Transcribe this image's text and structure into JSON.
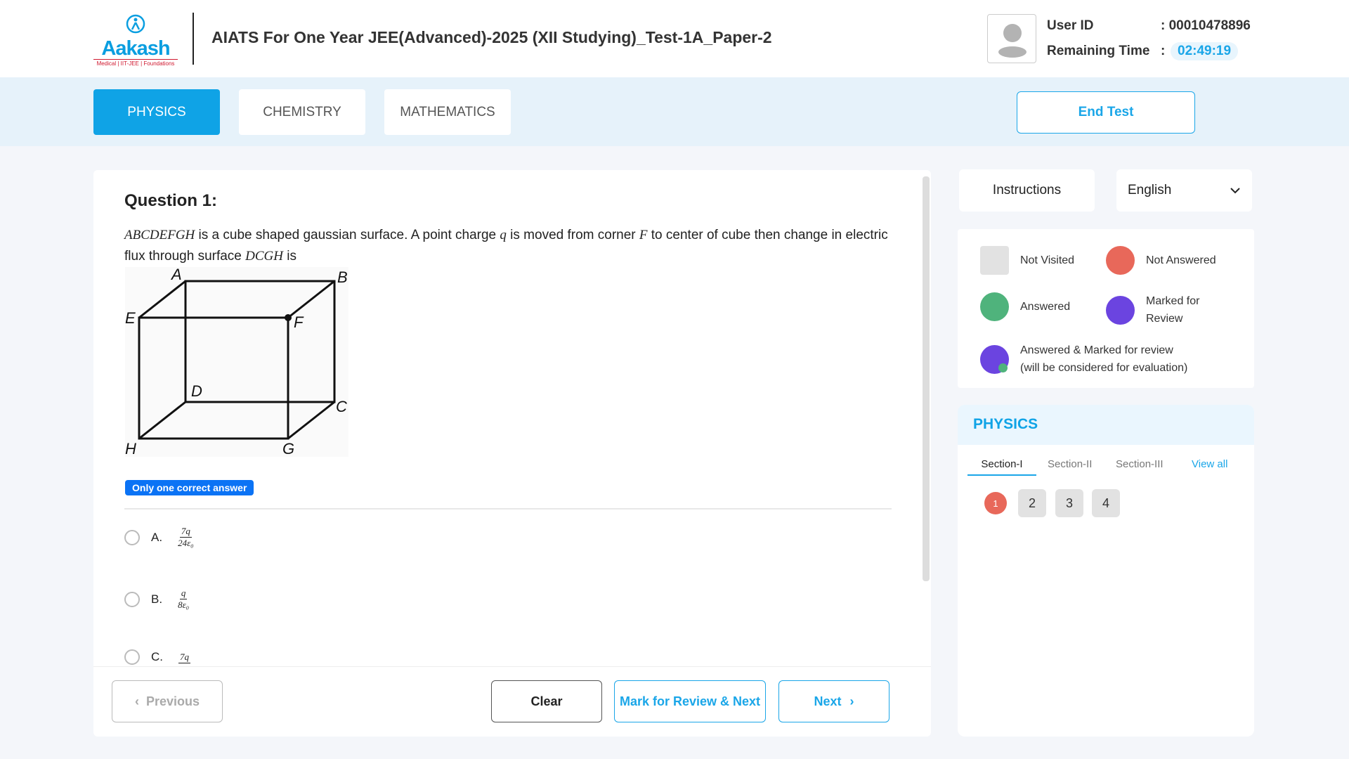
{
  "header": {
    "logo_text": "Aakash",
    "logo_sub": "Medical | IIT-JEE | Foundations",
    "title": "AIATS For One Year JEE(Advanced)-2025 (XII Studying)_Test-1A_Paper-2",
    "user_id_label": "User ID",
    "user_id": ": 00010478896",
    "time_label": "Remaining Time",
    "time_sep": ":",
    "time": "02:49:19"
  },
  "tabs": [
    {
      "label": "PHYSICS",
      "active": true
    },
    {
      "label": "CHEMISTRY"
    },
    {
      "label": "MATHEMATICS"
    }
  ],
  "end_test": "End Test",
  "question": {
    "title": "Question 1:",
    "text_parts": [
      "ABCDEFGH",
      " is a cube shaped gaussian surface. A point charge ",
      "q",
      " is moved from corner ",
      "F",
      " to center of cube then change in electric flux through surface ",
      "DCGH",
      " is"
    ],
    "figure_labels": {
      "A": "A",
      "B": "B",
      "C": "C",
      "D": "D",
      "E": "E",
      "F": "F",
      "G": "G",
      "H": "H"
    },
    "badge": "Only one correct answer",
    "options": [
      {
        "label": "A.",
        "num": "7q",
        "den": "24ε₀"
      },
      {
        "label": "B.",
        "num": "q",
        "den": "8ε₀"
      },
      {
        "label": "C.",
        "num": "7q",
        "den": ""
      }
    ]
  },
  "footer": {
    "previous": "Previous",
    "clear": "Clear",
    "mark": "Mark for Review & Next",
    "next": "Next"
  },
  "right": {
    "instructions": "Instructions",
    "language": "English",
    "legend": {
      "not_visited": "Not Visited",
      "not_answered": "Not Answered",
      "answered": "Answered",
      "marked": "Marked for Review",
      "answered_marked": "Answered & Marked for review",
      "answered_marked_note": "(will be considered for evaluation)"
    },
    "colors": {
      "not_visited": "#e2e2e2",
      "not_answered": "#e8685a",
      "answered": "#4fb37c",
      "marked": "#6b44e0",
      "accent": "#0fa3e6"
    },
    "palette": {
      "title": "PHYSICS",
      "sections": [
        "Section-I",
        "Section-II",
        "Section-III"
      ],
      "active_section": "Section-I",
      "view_all": "View all",
      "questions": [
        {
          "n": "1",
          "status": "not_answered"
        },
        {
          "n": "2",
          "status": "not_visited"
        },
        {
          "n": "3",
          "status": "not_visited"
        },
        {
          "n": "4",
          "status": "not_visited"
        }
      ]
    }
  }
}
